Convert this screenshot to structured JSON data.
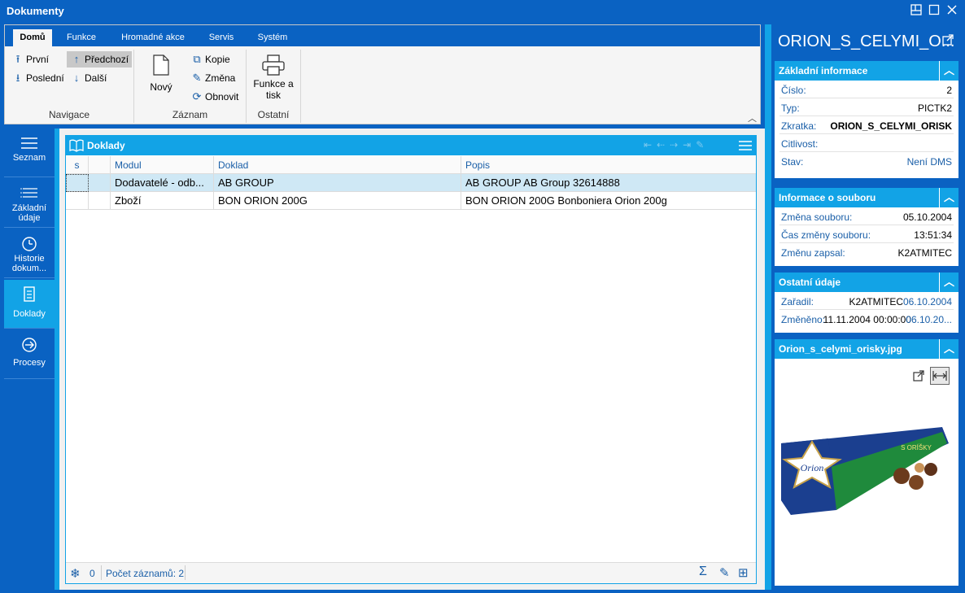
{
  "window": {
    "title": "Dokumenty"
  },
  "ribbon": {
    "tabs": [
      "Domů",
      "Funkce",
      "Hromadné akce",
      "Servis",
      "Systém"
    ],
    "navigation": {
      "first": "První",
      "previous": "Předchozí",
      "last": "Poslední",
      "next": "Další",
      "group_label": "Navigace"
    },
    "record": {
      "new": "Nový",
      "copy": "Kopie",
      "change": "Změna",
      "refresh": "Obnovit",
      "group_label": "Záznam"
    },
    "other": {
      "functions_line1": "Funkce a",
      "functions_line2": "tisk",
      "group_label": "Ostatní"
    }
  },
  "sidebar": {
    "items": [
      {
        "label": "Seznam",
        "icon": "list-icon"
      },
      {
        "label": "Základní údaje",
        "icon": "detail-list-icon"
      },
      {
        "label": "Historie dokum...",
        "icon": "clock-icon"
      },
      {
        "label": "Doklady",
        "icon": "document-icon",
        "active": true
      },
      {
        "label": "Procesy",
        "icon": "arrow-circle-icon"
      }
    ]
  },
  "panel": {
    "title": "Doklady",
    "columns": [
      "s",
      "",
      "Modul",
      "Doklad",
      "Popis"
    ],
    "rows": [
      {
        "s": "",
        "flag": "",
        "modul": "Dodavatelé - odb...",
        "doklad": "AB GROUP",
        "popis": "AB GROUP AB Group 32614888"
      },
      {
        "s": "",
        "flag": "",
        "modul": "Zboží",
        "doklad": "BON ORION 200G",
        "popis": "BON ORION 200G Bonboniera Orion 200g"
      }
    ],
    "status": {
      "count_value": "0",
      "records_label": "Počet záznamů: 2"
    }
  },
  "detail": {
    "title": "ORION_S_CELYMI_O...",
    "basic": {
      "heading": "Základní informace",
      "cislo_label": "Číslo:",
      "cislo": "2",
      "typ_label": "Typ:",
      "typ": "PICTK2",
      "zkratka_label": "Zkratka:",
      "zkratka": "ORION_S_CELYMI_ORISK",
      "citlivost_label": "Citlivost:",
      "citlivost": "",
      "stav_label": "Stav:",
      "stav": "Není DMS"
    },
    "file": {
      "heading": "Informace o souboru",
      "changed_label": "Změna souboru:",
      "changed": "05.10.2004",
      "time_label": "Čas změny souboru:",
      "time": "13:51:34",
      "by_label": "Změnu zapsal:",
      "by": "K2ATMITEC"
    },
    "other": {
      "heading": "Ostatní údaje",
      "assigned_label": "Zařadil:",
      "assigned_user": "K2ATMITEC",
      "assigned_date": "06.10.2004",
      "modified_label": "Změněno:",
      "modified_value": "11.11.2004 00:00:00",
      "modified_extra": "06.10.20..."
    },
    "image": {
      "heading": "Orion_s_celymi_orisky.jpg",
      "box_text_brand": "Orion",
      "box_text_flavor": "S ORÍŠKY"
    }
  }
}
